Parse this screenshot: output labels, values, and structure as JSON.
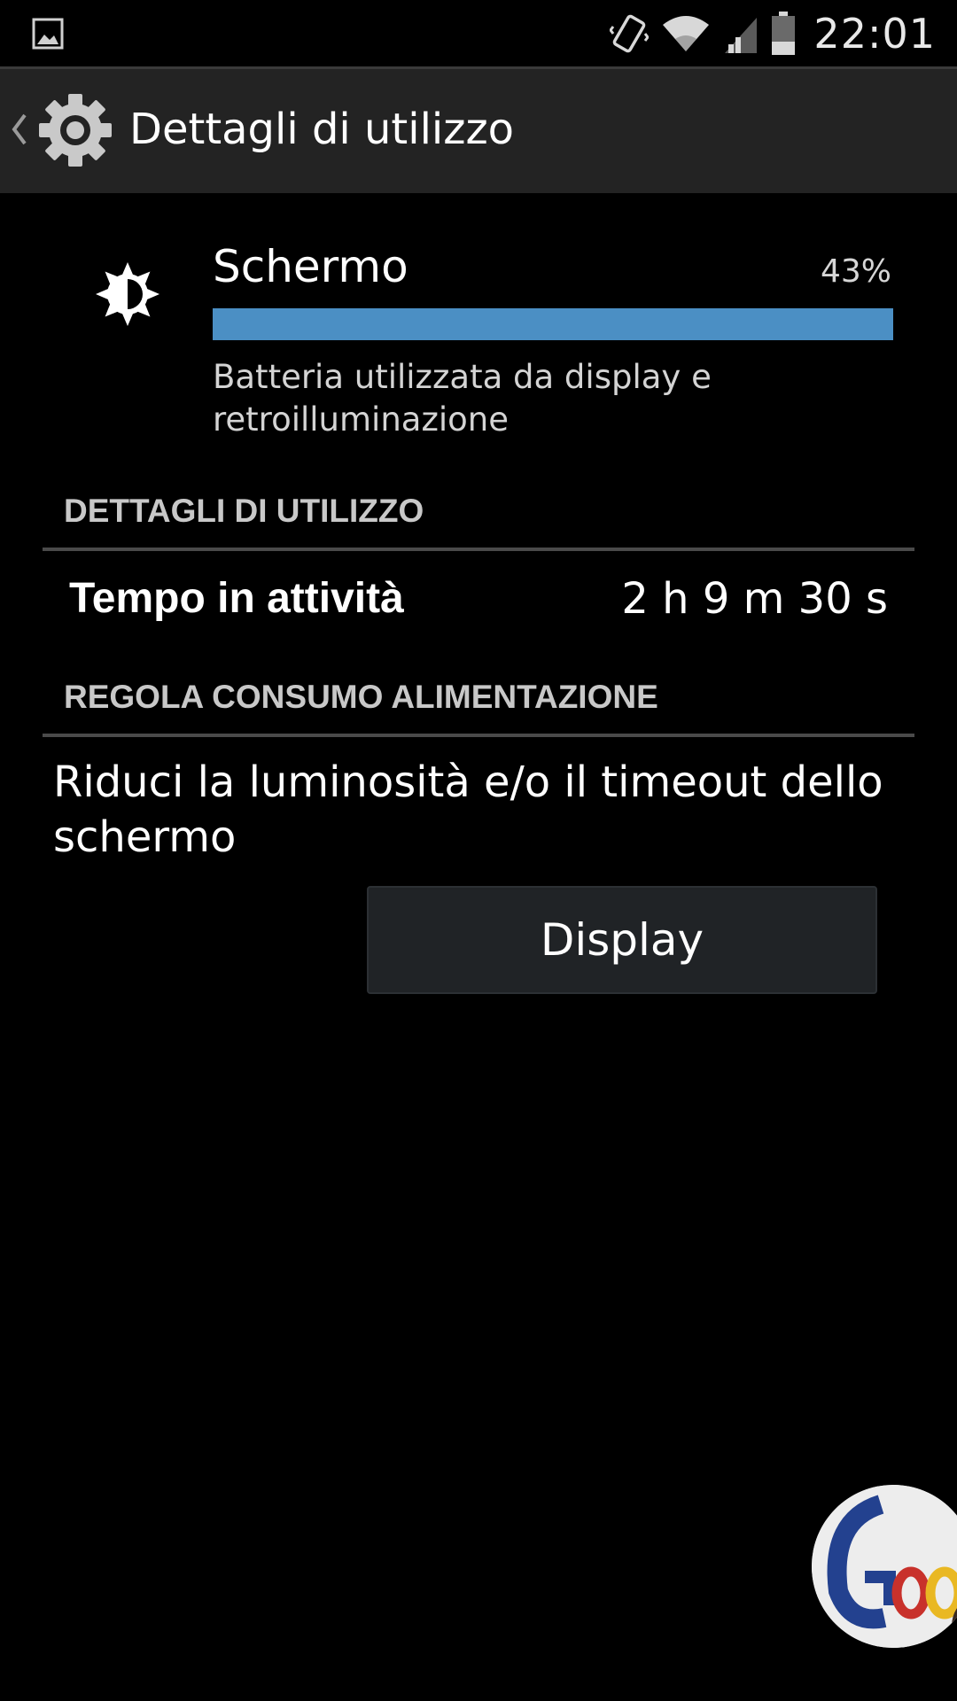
{
  "status_bar": {
    "time": "22:01",
    "icons": [
      "gallery-notification-icon",
      "vibrate-icon",
      "wifi-icon",
      "cell-signal-icon",
      "battery-icon"
    ]
  },
  "action_bar": {
    "title": "Dettagli di utilizzo",
    "icons": [
      "up-chevron-icon",
      "settings-gear-icon"
    ]
  },
  "app_usage": {
    "icon": "brightness-icon",
    "name": "Schermo",
    "percent_label": "43%",
    "usage_fraction": 0.43,
    "description": "Batteria utilizzata da display e retroilluminazione"
  },
  "usage_details": {
    "header": "DETTAGLI DI UTILIZZO",
    "rows": [
      {
        "label": "Tempo in attività",
        "value": "2 h 9 m 30 s"
      }
    ]
  },
  "power_adjust": {
    "header": "REGOLA CONSUMO ALIMENTAZIONE",
    "suggestion": "Riduci la luminosità e/o il timeout dello schermo",
    "button_label": "Display"
  },
  "colors": {
    "background": "#000000",
    "action_bar": "#232323",
    "accent_bar": "#4b8fc4",
    "section_text": "#c8c8c8",
    "divider": "#4a4a4a",
    "button_bg": "#202326"
  }
}
